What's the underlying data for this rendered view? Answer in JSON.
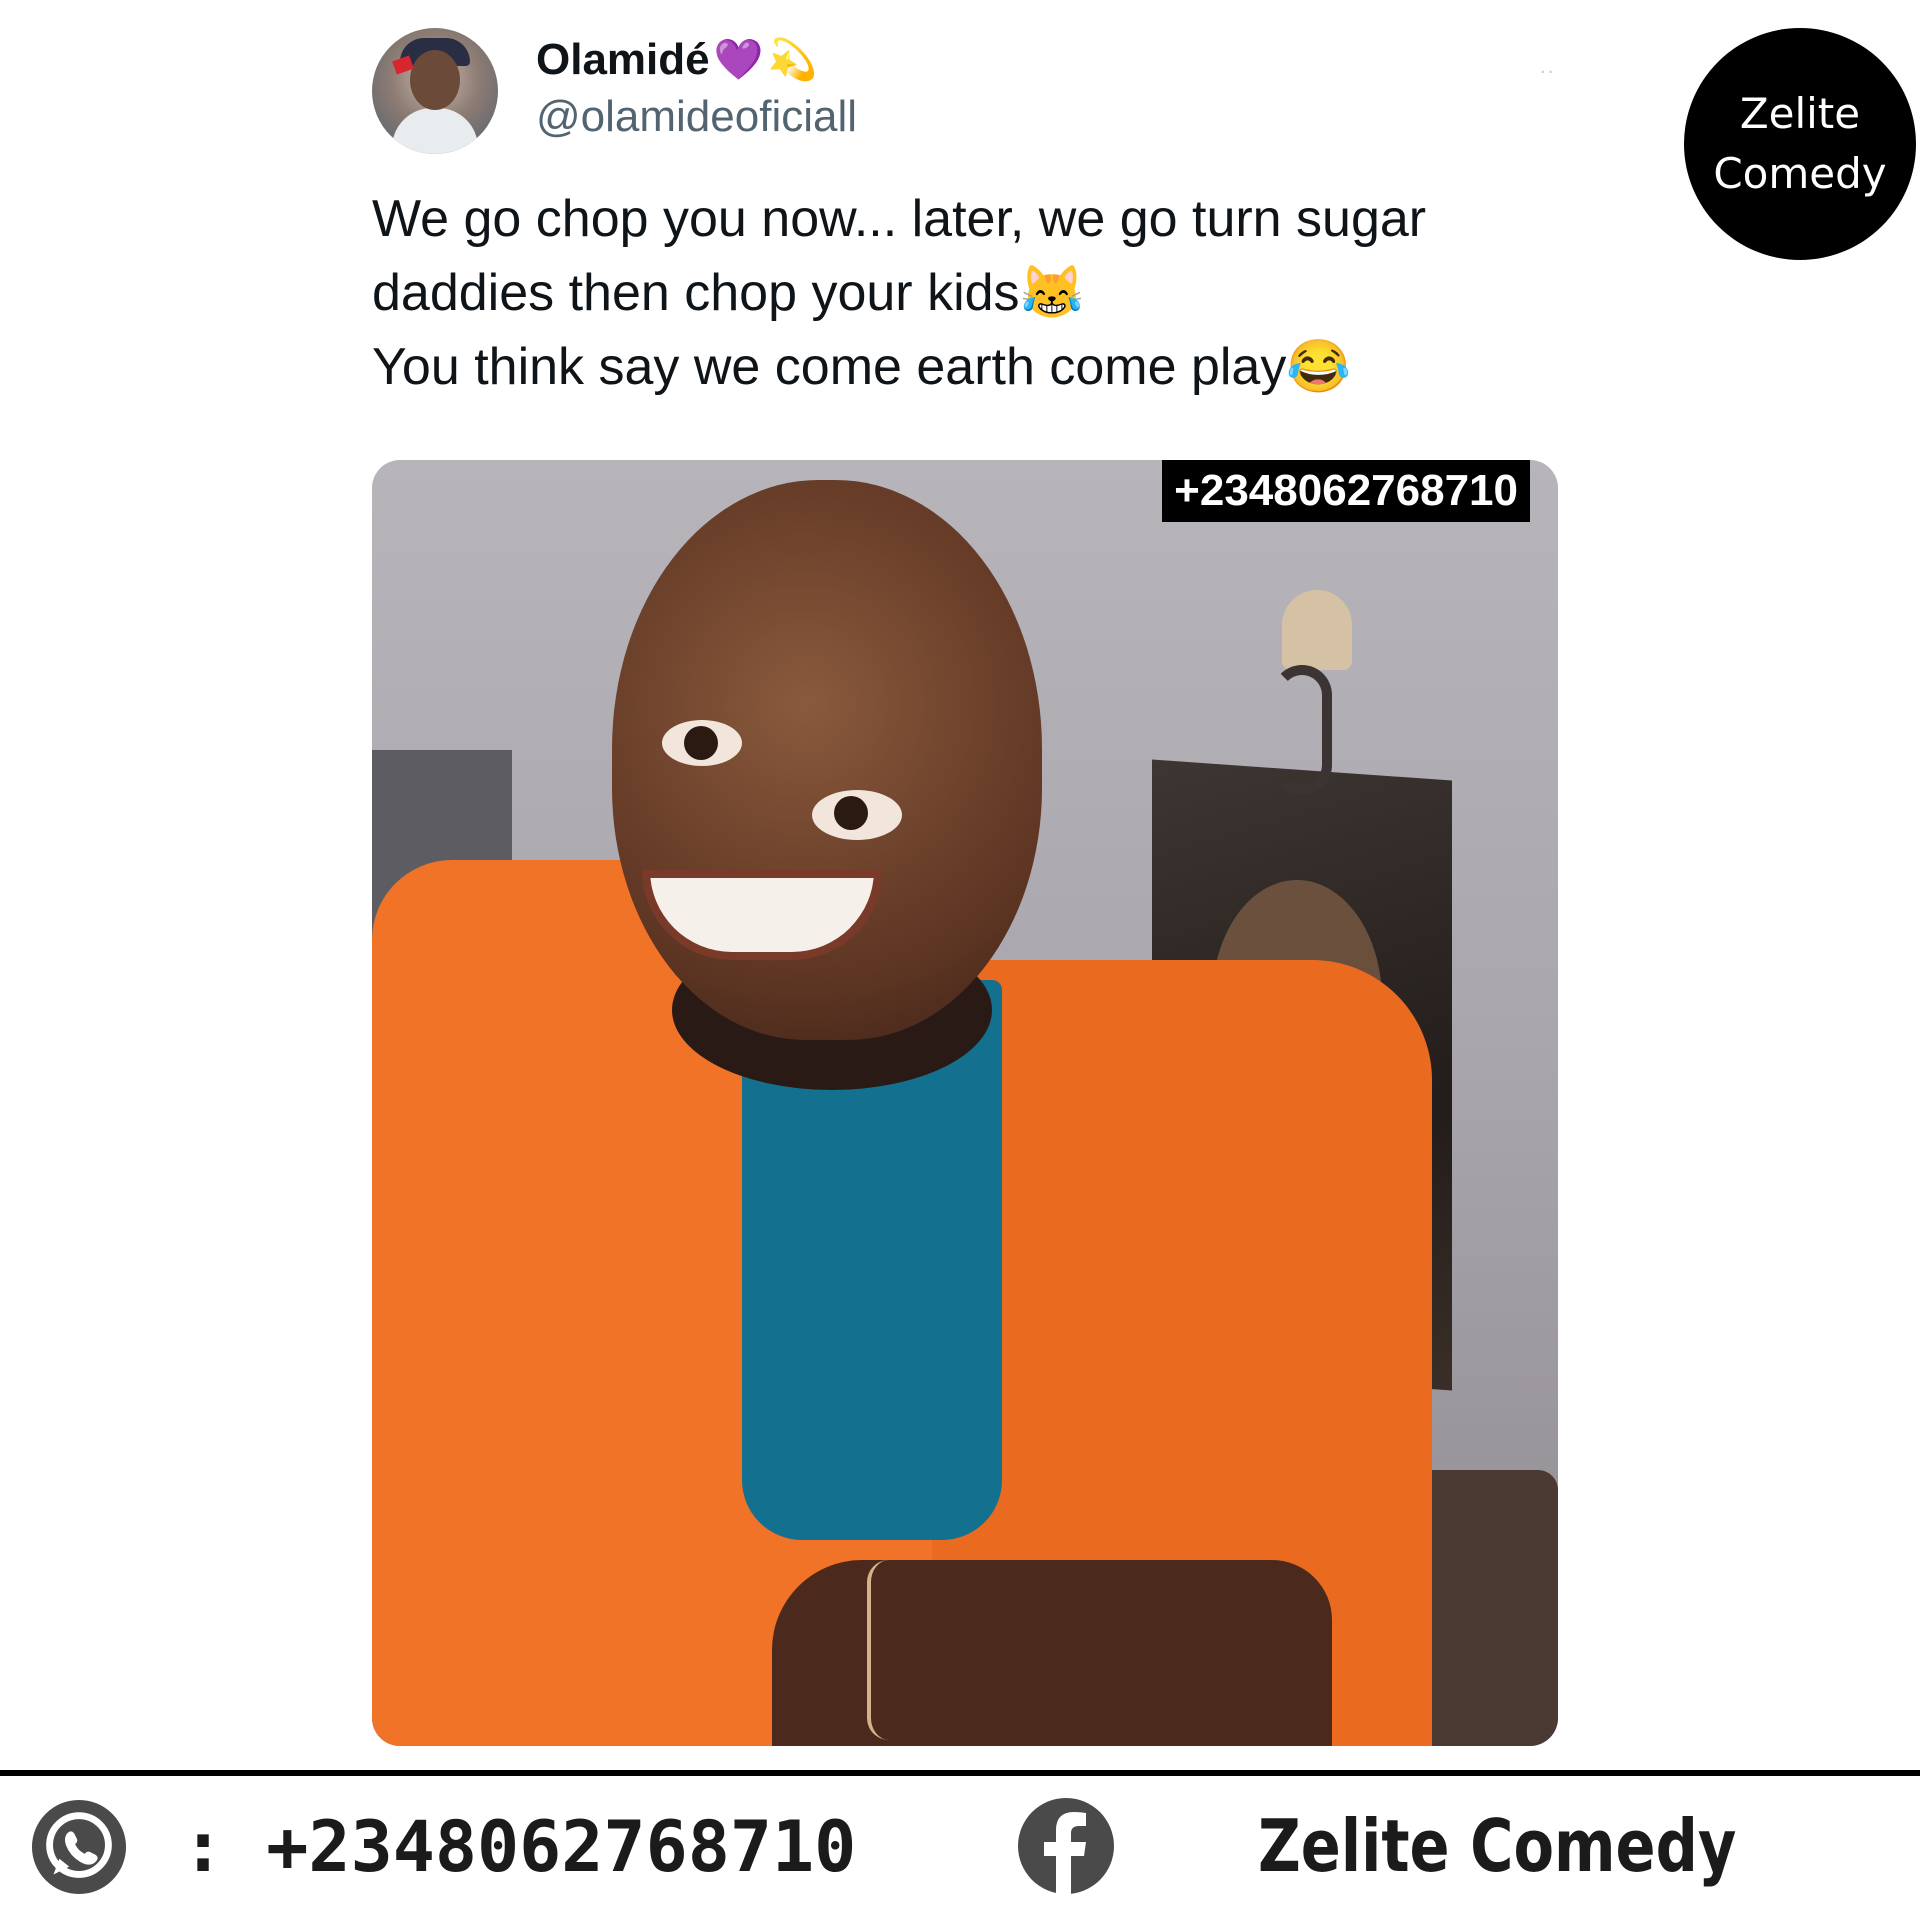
{
  "tweet": {
    "author_name": "Olamidé",
    "name_emojis": [
      "💜",
      "💫"
    ],
    "handle": "@olamideoficiall",
    "more_glyph": "··",
    "lines": [
      "We go chop you now... later, we go turn sugar",
      "daddies then chop your kids😹",
      "You think say we come earth come play😂"
    ]
  },
  "photo": {
    "watermark_phone": "+2348062768710"
  },
  "badge": {
    "line1": "Zelite",
    "line2": "Comedy"
  },
  "footer": {
    "whatsapp_icon": "whatsapp-icon",
    "whatsapp_text": ": +2348062768710",
    "facebook_icon": "facebook-icon",
    "facebook_name": "Zelite Comedy"
  },
  "colors": {
    "background": "#ffffff",
    "text": "#0f1419",
    "handle": "#536471",
    "jacket": "#f07327",
    "shirt": "#13708f",
    "badge_bg": "#000000",
    "footer_icon": "#4a4a4a"
  }
}
